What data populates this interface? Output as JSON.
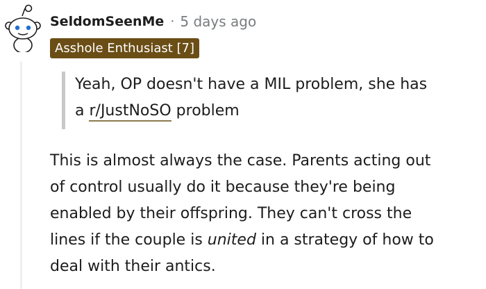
{
  "comment": {
    "author": "SeldomSeenMe",
    "separator": "·",
    "timestamp": "5 days ago",
    "flair": "Asshole Enthusiast [7]",
    "flair_color": "#6b4e16",
    "avatar_icon": "snoo-avatar-icon",
    "quote": {
      "line1": "Yeah, OP doesn't have a MIL problem, she has",
      "line2_prefix": "a ",
      "link_text": "r/JustNoSO",
      "line2_suffix": " problem"
    },
    "body": {
      "line1": "This is almost always the case. Parents acting out",
      "line2": "of control usually do it because they're being",
      "line3": "enabled by their offspring. They can't cross the",
      "line4_prefix": "lines if the couple is ",
      "line4_em": "united",
      "line4_suffix": " in a strategy of how to",
      "line5": "deal with their antics."
    }
  }
}
